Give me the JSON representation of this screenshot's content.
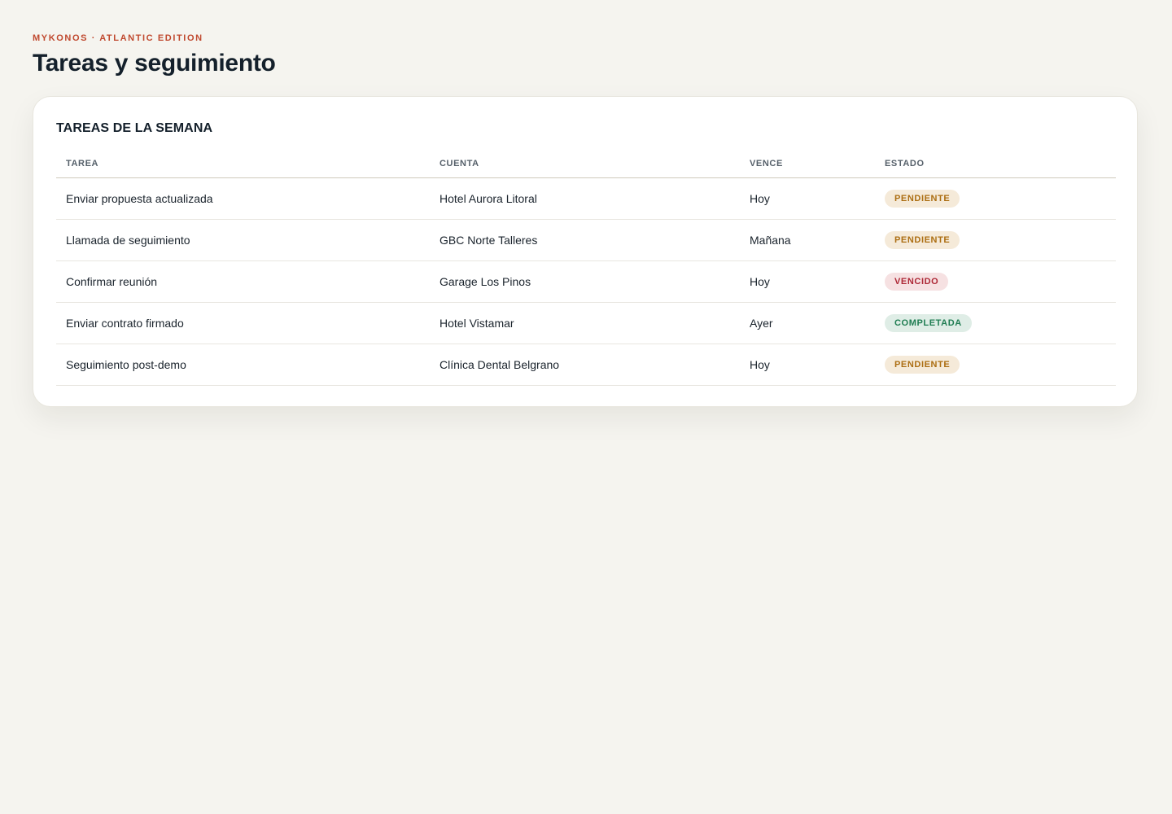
{
  "header": {
    "eyebrow": "MYKONOS · ATLANTIC EDITION",
    "title": "Tareas y seguimiento"
  },
  "tasks_card": {
    "title": "TAREAS DE LA SEMANA",
    "columns": {
      "task": "TAREA",
      "account": "CUENTA",
      "due": "VENCE",
      "status": "ESTADO"
    },
    "rows": [
      {
        "task": "Enviar propuesta actualizada",
        "account": "Hotel Aurora Litoral",
        "due": "Hoy",
        "status": "PENDIENTE",
        "status_kind": "pendiente"
      },
      {
        "task": "Llamada de seguimiento",
        "account": "GBC Norte Talleres",
        "due": "Mañana",
        "status": "PENDIENTE",
        "status_kind": "pendiente"
      },
      {
        "task": "Confirmar reunión",
        "account": "Garage Los Pinos",
        "due": "Hoy",
        "status": "VENCIDO",
        "status_kind": "vencido"
      },
      {
        "task": "Enviar contrato firmado",
        "account": "Hotel Vistamar",
        "due": "Ayer",
        "status": "COMPLETADA",
        "status_kind": "completada"
      },
      {
        "task": "Seguimiento post-demo",
        "account": "Clínica Dental Belgrano",
        "due": "Hoy",
        "status": "PENDIENTE",
        "status_kind": "pendiente"
      }
    ]
  },
  "colors": {
    "background": "#f5f4ef",
    "accent": "#c0492f",
    "status_pendiente": "#ac6e12",
    "status_vencido": "#ad2836",
    "status_completada": "#1f7d52"
  }
}
